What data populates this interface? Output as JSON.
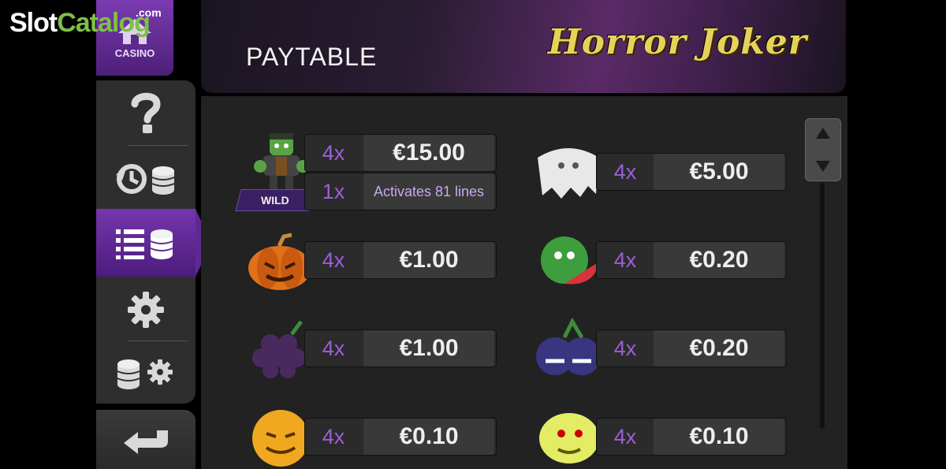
{
  "watermark": {
    "slot": "Slot",
    "catalog": "Catalog",
    "com": ".com"
  },
  "sidebar": {
    "casino_label": "CASINO",
    "items": [
      {
        "name": "help",
        "icon": "question-icon"
      },
      {
        "name": "history",
        "icon": "history-coins-icon"
      },
      {
        "name": "paytable",
        "icon": "paytable-list-icon",
        "active": true
      },
      {
        "name": "settings",
        "icon": "gear-icon"
      },
      {
        "name": "bet-settings",
        "icon": "coins-gear-icon"
      },
      {
        "name": "back",
        "icon": "back-arrow-icon"
      }
    ]
  },
  "header": {
    "title": "PAYTABLE",
    "logo": "Horror Joker"
  },
  "paytable": {
    "wild": {
      "symbol": "monster-wild",
      "tag": "WILD",
      "mult1": "4x",
      "val1": "€15.00",
      "mult2": "1x",
      "val2": "Activates 81 lines"
    },
    "left": [
      {
        "symbol": "pumpkin",
        "mult": "4x",
        "val": "€1.00"
      },
      {
        "symbol": "grapes",
        "mult": "4x",
        "val": "€1.00"
      },
      {
        "symbol": "orange",
        "mult": "4x",
        "val": "€0.10"
      }
    ],
    "right": [
      {
        "symbol": "ghost",
        "mult": "4x",
        "val": "€5.00"
      },
      {
        "symbol": "watermelon",
        "mult": "4x",
        "val": "€0.20"
      },
      {
        "symbol": "plums",
        "mult": "4x",
        "val": "€0.20"
      },
      {
        "symbol": "lemon",
        "mult": "4x",
        "val": "€0.10"
      }
    ]
  },
  "colors": {
    "accent": "#7436ad",
    "multiplier": "#9b5fd8",
    "logo": "#e6d25a"
  }
}
